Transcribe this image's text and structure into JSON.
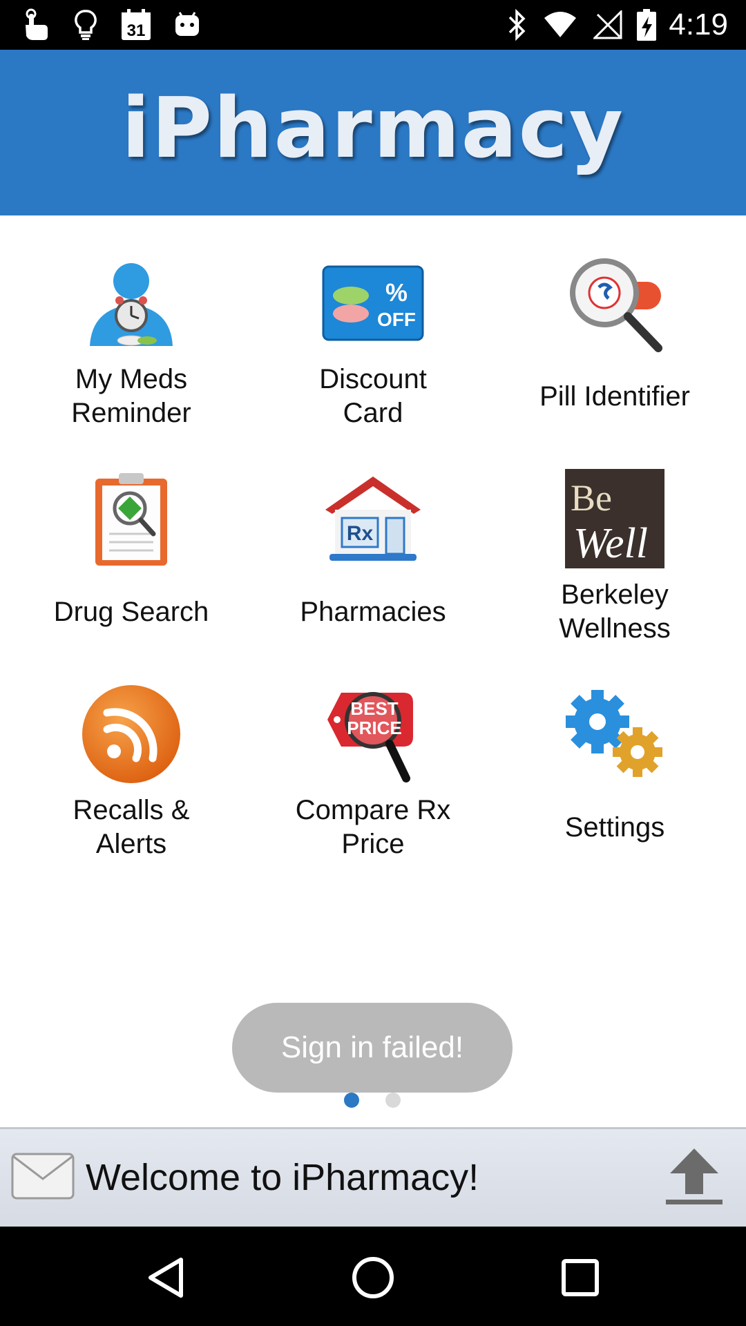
{
  "status_bar": {
    "time": "4:19",
    "calendar_day": "31",
    "icons": [
      "touch-icon",
      "lightbulb-icon",
      "calendar-icon",
      "android-icon",
      "bluetooth-icon",
      "wifi-icon",
      "no-signal-icon",
      "battery-charging-icon"
    ]
  },
  "header": {
    "title": "iPharmacy"
  },
  "grid": {
    "items": [
      {
        "label": "My Meds\nReminder",
        "icon": "meds-reminder-icon"
      },
      {
        "label": "Discount\nCard",
        "icon": "discount-card-icon",
        "badge_top": "%",
        "badge_bottom": "OFF"
      },
      {
        "label": "Pill Identifier",
        "icon": "pill-identifier-icon"
      },
      {
        "label": "Drug Search",
        "icon": "drug-search-icon"
      },
      {
        "label": "Pharmacies",
        "icon": "pharmacy-icon",
        "badge": "Rx"
      },
      {
        "label": "Berkeley\nWellness",
        "icon": "berkeley-wellness-icon",
        "logo_line1": "Be",
        "logo_line2": "Well"
      },
      {
        "label": "Recalls &\nAlerts",
        "icon": "rss-icon"
      },
      {
        "label": "Compare Rx\nPrice",
        "icon": "best-price-icon",
        "tag_line1": "BEST",
        "tag_line2": "PRICE"
      },
      {
        "label": "Settings",
        "icon": "gears-icon"
      }
    ]
  },
  "toast": {
    "text": "Sign in failed!"
  },
  "pager": {
    "count": 2,
    "active_index": 0,
    "active_color": "#2b78c4",
    "inactive_color": "#d9d9d9"
  },
  "message_bar": {
    "text": "Welcome to iPharmacy!",
    "icons": [
      "mail-icon",
      "upload-icon"
    ]
  },
  "nav_bar": {
    "buttons": [
      "back-icon",
      "home-icon",
      "recents-icon"
    ]
  },
  "colors": {
    "header_bg": "#2b78c4",
    "status_bg": "#000000",
    "toast_bg": "#b9b9b9"
  }
}
